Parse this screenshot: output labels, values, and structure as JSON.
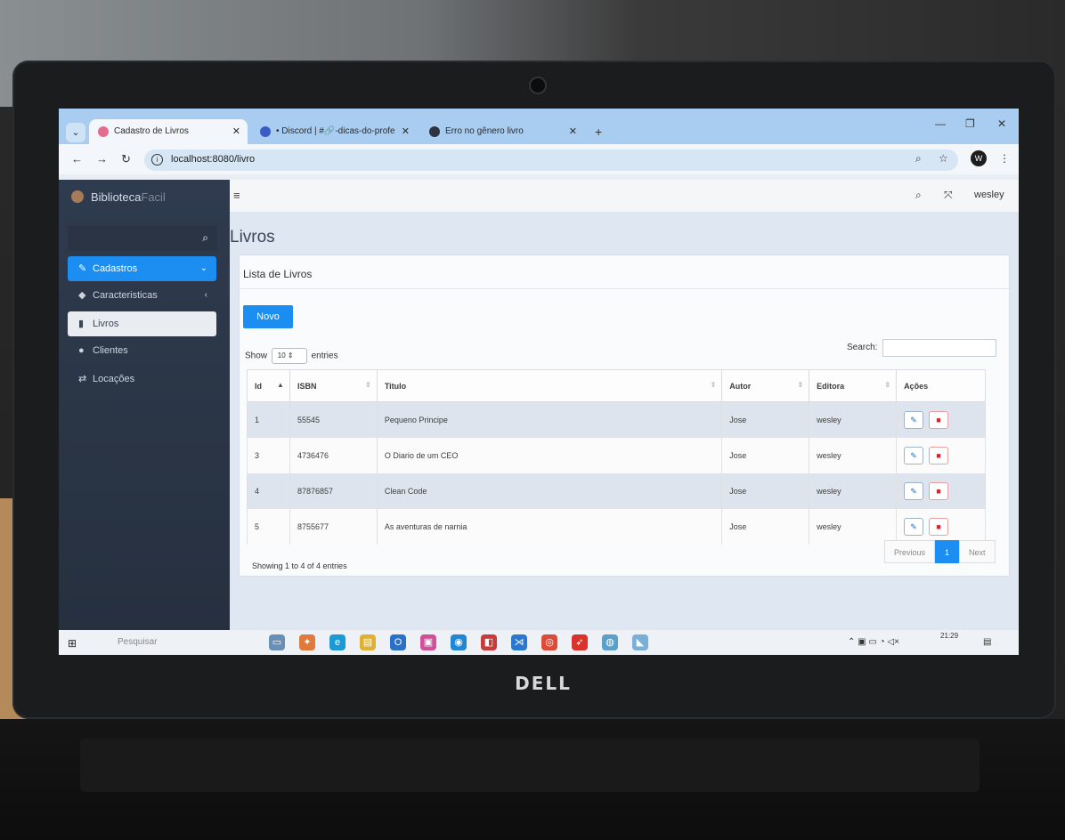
{
  "browser": {
    "tabs": [
      {
        "title": "Cadastro de Livros",
        "active": true
      },
      {
        "title": "• Discord | #🔗-dicas-do-profe",
        "active": false
      },
      {
        "title": "Erro no gênero livro",
        "active": false
      }
    ],
    "url": "localhost:8080/livro",
    "profile_initial": "W"
  },
  "app": {
    "brand_main": "Biblioteca",
    "brand_dim": "Facil",
    "user": "wesley",
    "sidebar": [
      {
        "label": "Cadastros",
        "icon": "pencil-icon",
        "state": "open"
      },
      {
        "label": "Caracteristicas",
        "icon": "tags-icon",
        "state": "collapsed"
      },
      {
        "label": "Livros",
        "icon": "book-icon",
        "state": "selected"
      },
      {
        "label": "Clientes",
        "icon": "user-icon",
        "state": "normal"
      },
      {
        "label": "Locações",
        "icon": "retweet-icon",
        "state": "normal"
      }
    ]
  },
  "page": {
    "title": "Livros",
    "card_title": "Lista de Livros",
    "new_button": "Novo",
    "show_label": "Show",
    "entries_label": "entries",
    "page_size": "10",
    "search_label": "Search:",
    "columns": [
      "Id",
      "ISBN",
      "Titulo",
      "Autor",
      "Editora",
      "Ações"
    ],
    "rows": [
      {
        "id": "1",
        "isbn": "55545",
        "titulo": "Pequeno Principe",
        "autor": "Jose",
        "editora": "wesley"
      },
      {
        "id": "3",
        "isbn": "4736476",
        "titulo": "O Diario de um CEO",
        "autor": "Jose",
        "editora": "wesley"
      },
      {
        "id": "4",
        "isbn": "87876857",
        "titulo": "Clean Code",
        "autor": "Jose",
        "editora": "wesley"
      },
      {
        "id": "5",
        "isbn": "8755677",
        "titulo": "As aventuras de narnia",
        "autor": "Jose",
        "editora": "wesley"
      }
    ],
    "showing": "Showing 1 to 4 of 4 entries",
    "pager": {
      "previous": "Previous",
      "current": "1",
      "next": "Next"
    }
  },
  "taskbar": {
    "search_placeholder": "Pesquisar",
    "time": "21:29"
  },
  "laptop_brand": "DELL"
}
